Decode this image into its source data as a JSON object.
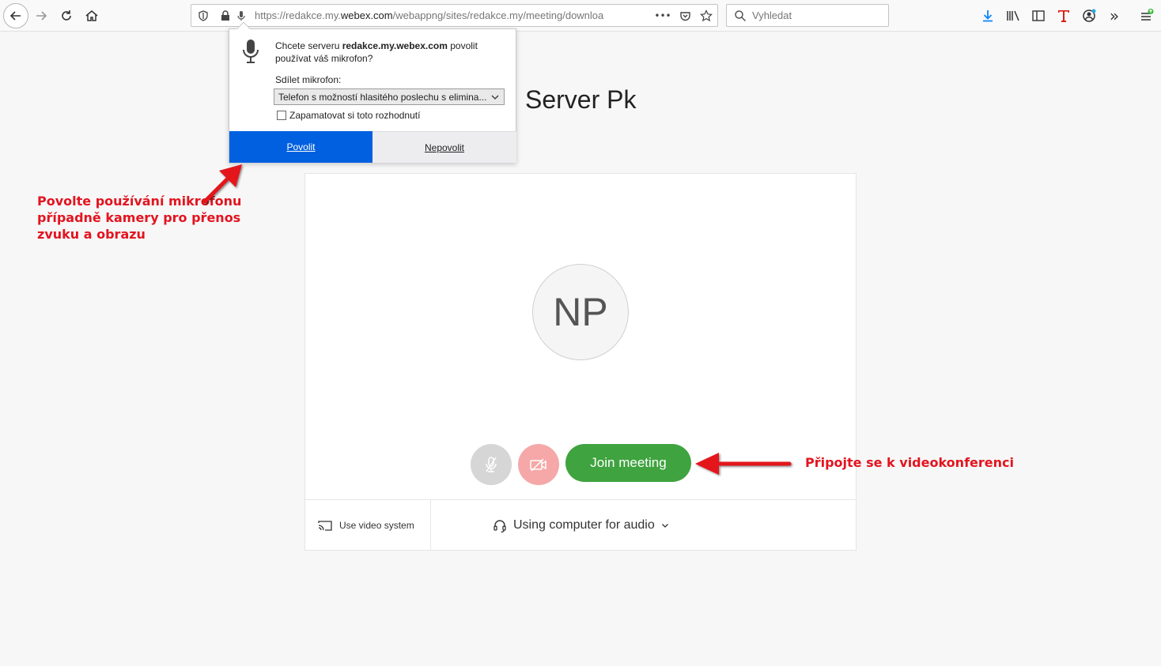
{
  "browser": {
    "url_prefix": "https://redakce.my.",
    "url_domain": "webex.com",
    "url_suffix": "/webappng/sites/redakce.my/meeting/downloa",
    "search_placeholder": "Vyhledat",
    "overflow_dots": "•••",
    "extensions_chevron": "»"
  },
  "permission_popup": {
    "question_prefix": "Chcete serveru ",
    "question_domain": "redakce.my.webex.com",
    "question_suffix": " povolit používat váš mikrofon?",
    "share_label": "Sdílet mikrofon:",
    "selected_device": "Telefon s možností hlasitého poslechu s elimina...",
    "remember_label": "Zapamatovat si toto rozhodnutí",
    "allow_label": "Povolit",
    "deny_label": "Nepovolit"
  },
  "meeting": {
    "title": "Server Pk",
    "avatar_initials": "NP",
    "join_label": "Join meeting",
    "video_system_label": "Use video system",
    "audio_option_label": "Using computer for audio"
  },
  "annotations": {
    "left_text": "Povolte používání mikrofonu případně kamery pro přenos zvuku a obrazu",
    "right_text": "Připojte se k videokonferenci",
    "color": "#e3141f"
  },
  "colors": {
    "allow_button": "#0060df",
    "join_button": "#3fa33f",
    "muted_mic_button": "#d6d6d6",
    "camera_off_button": "#f6a7a7"
  }
}
